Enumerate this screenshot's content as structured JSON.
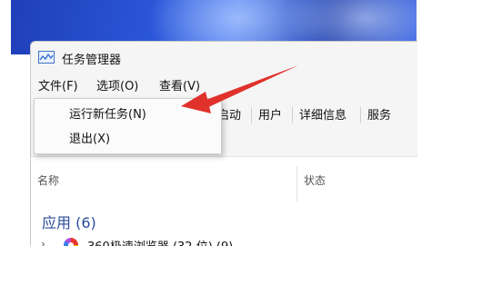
{
  "window": {
    "title": "任务管理器"
  },
  "menubar": {
    "items": [
      "文件(F)",
      "选项(O)",
      "查看(V)"
    ]
  },
  "file_menu": {
    "items": [
      "运行新任务(N)",
      "退出(X)"
    ]
  },
  "tabs": [
    "启动",
    "用户",
    "详细信息",
    "服务"
  ],
  "columns": {
    "name": "名称",
    "status": "状态"
  },
  "group": {
    "label": "应用 (6)"
  },
  "process": {
    "name": "360极速浏览器 (32 位) (9)"
  },
  "colors": {
    "arrow": "#e0312b",
    "group_label": "#2b4a9a"
  }
}
